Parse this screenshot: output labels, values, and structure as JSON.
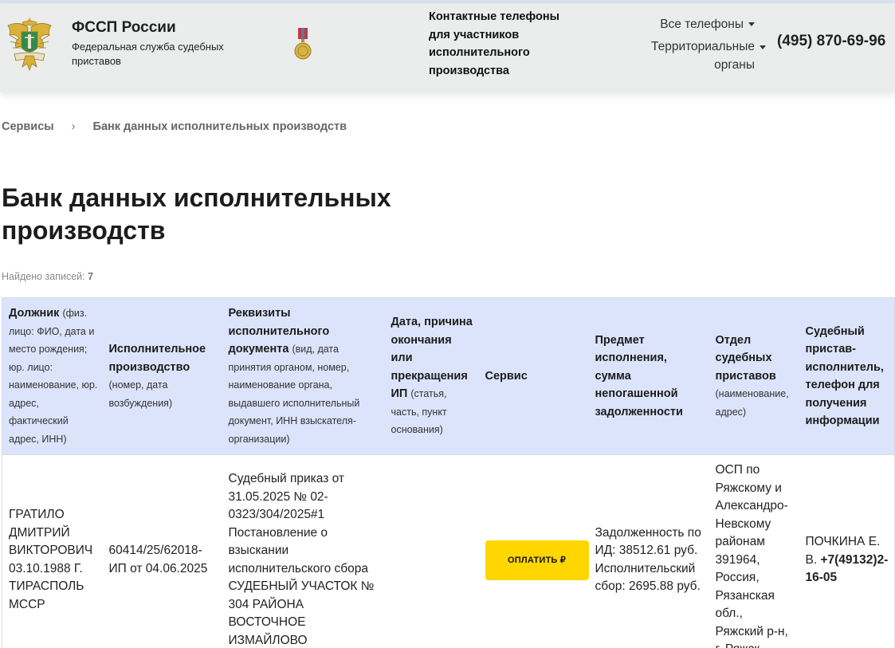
{
  "header": {
    "org_name": "ФССП России",
    "org_subtitle": "Федеральная служба судебных приставов",
    "contacts_title": "Контактные телефоны для участников исполнительного производства",
    "dropdown_all_phones": "Все телефоны",
    "dropdown_territorial": "Территориальные органы",
    "phone": "(495) 870-69-96"
  },
  "breadcrumb": {
    "items": [
      "Сервисы",
      "Банк данных исполнительных производств"
    ],
    "separator": "›"
  },
  "page": {
    "title": "Банк данных исполнительных производств",
    "found_label": "Найдено записей:",
    "found_count": "7"
  },
  "table": {
    "columns": [
      {
        "title": "Должник",
        "hint": "(физ. лицо: ФИО, дата и место рождения; юр. лицо: наименование, юр. адрес, фактический адрес, ИНН)"
      },
      {
        "title": "Исполнительное производство",
        "hint": "(номер, дата возбуждения)"
      },
      {
        "title": "Реквизиты исполнительного документа",
        "hint": "(вид, дата принятия органом, номер, наименование органа, выдавшего исполнительный документ, ИНН взыскателя-организации)"
      },
      {
        "title": "Дата, причина окончания или прекращения ИП",
        "hint": "(статья, часть, пункт основания)"
      },
      {
        "title": "Сервис",
        "hint": ""
      },
      {
        "title": "Предмет исполнения, сумма непогашенной задолженности",
        "hint": ""
      },
      {
        "title": "Отдел судебных приставов",
        "hint": "(наименование, адрес)"
      },
      {
        "title": "Судебный пристав-исполнитель, телефон для получения информации",
        "hint": ""
      }
    ],
    "rows": [
      {
        "debtor": "ГРАТИЛО ДМИТРИЙ ВИКТОРОВИЧ 03.10.1988 Г. ТИРАСПОЛЬ МССР",
        "proceeding": "60414/25/62018-ИП от 04.06.2025",
        "document": "Судебный приказ от 31.05.2025 № 02-0323/304/2025#1 Постановление о взыскании исполнительского сбора СУДЕБНЫЙ УЧАСТОК № 304 РАЙОНА ВОСТОЧНОЕ ИЗМАЙЛОВО",
        "end_date": "",
        "pay_button": "ОПЛАТИТЬ ₽",
        "subject": "Задолженность по ИД: 38512.61 руб. Исполнительский сбор: 2695.88 руб.",
        "department": "ОСП по Ряжскому и Александро-Невскому районам 391964, Россия, Рязанская обл., Ряжский р-н, г. Ряжск,",
        "bailiff_name": "ПОЧКИНА Е. В.",
        "bailiff_phone": "+7(49132)2-16-05"
      }
    ]
  },
  "colors": {
    "header_bg": "#ebeded",
    "table_header_bg": "#dce4fb",
    "pay_button_bg": "#ffd600",
    "emblem_gold": "#d8b23a"
  },
  "icons": {
    "emblem": "fssp-emblem-icon",
    "medal": "medal-icon",
    "caret": "caret-down-icon"
  }
}
